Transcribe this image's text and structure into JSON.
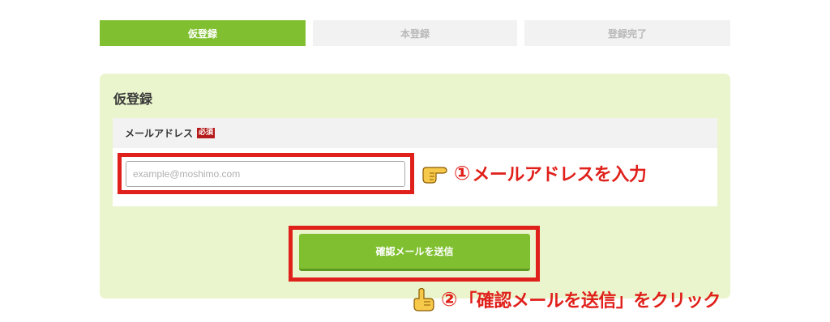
{
  "steps": [
    {
      "label": "仮登録"
    },
    {
      "label": "本登録"
    },
    {
      "label": "登録完了"
    }
  ],
  "panel": {
    "title": "仮登録",
    "email_label": "メールアドレス",
    "required_badge": "必須",
    "email_value": "",
    "email_placeholder": "example@moshimo.com",
    "submit_label": "確認メールを送信"
  },
  "annotations": {
    "note1_num": "①",
    "note1_text": "メールアドレスを入力",
    "note2_num": "②",
    "note2_text": "「確認メールを送信」をクリック",
    "color": "#e0201a"
  },
  "colors": {
    "accent": "#80c030",
    "panel_bg": "#eaf5cd",
    "inactive_step": "#f2f2f2"
  }
}
